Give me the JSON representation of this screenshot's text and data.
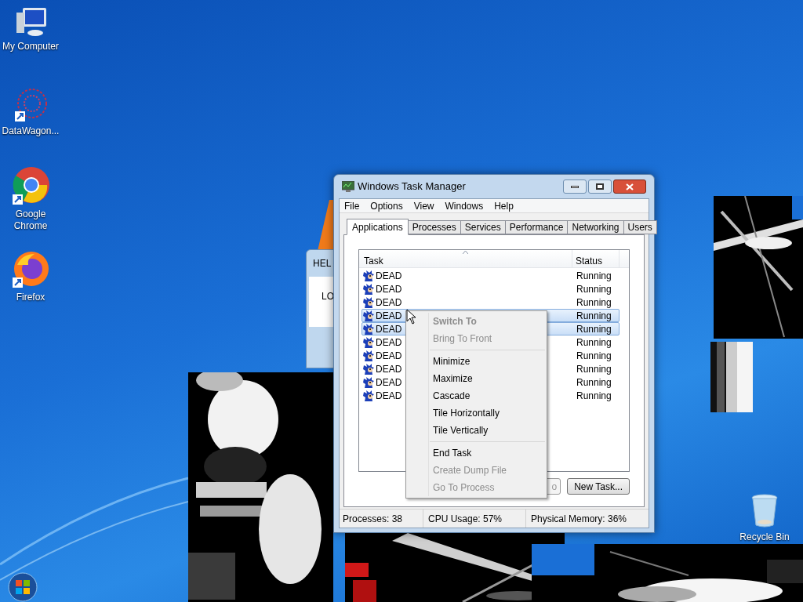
{
  "desktop_icons": [
    {
      "label": "My Computer",
      "kind": "computer"
    },
    {
      "label": "DataWagon...",
      "kind": "web"
    },
    {
      "label": "Google Chrome",
      "kind": "chrome"
    },
    {
      "label": "Firefox",
      "kind": "firefox"
    },
    {
      "label": "Recycle Bin",
      "kind": "bin"
    }
  ],
  "background_dialog": {
    "title": "HEL",
    "text": "LO"
  },
  "task_manager": {
    "title": "Windows Task Manager",
    "menu": [
      "File",
      "Options",
      "View",
      "Windows",
      "Help"
    ],
    "tabs": [
      {
        "label": "Applications",
        "selected": true
      },
      {
        "label": "Processes",
        "selected": false
      },
      {
        "label": "Services",
        "selected": false
      },
      {
        "label": "Performance",
        "selected": false
      },
      {
        "label": "Networking",
        "selected": false
      },
      {
        "label": "Users",
        "selected": false
      }
    ],
    "columns": [
      "Task",
      "Status"
    ],
    "rows": [
      {
        "task": "DEAD",
        "status": "Running",
        "selected": false
      },
      {
        "task": "DEAD",
        "status": "Running",
        "selected": false
      },
      {
        "task": "DEAD",
        "status": "Running",
        "selected": false
      },
      {
        "task": "DEAD",
        "status": "Running",
        "selected": true
      },
      {
        "task": "DEAD",
        "status": "Running",
        "selected": true
      },
      {
        "task": "DEAD",
        "status": "Running",
        "selected": false
      },
      {
        "task": "DEAD",
        "status": "Running",
        "selected": false
      },
      {
        "task": "DEAD",
        "status": "Running",
        "selected": false
      },
      {
        "task": "DEAD",
        "status": "Running",
        "selected": false
      },
      {
        "task": "DEAD",
        "status": "Running",
        "selected": false
      }
    ],
    "buttons": [
      "o",
      "New Task..."
    ],
    "status_bar": [
      "Processes: 38",
      "CPU Usage: 57%",
      "Physical Memory: 36%"
    ]
  },
  "context_menu": [
    {
      "kind": "item",
      "label": "Switch To",
      "disabled": true,
      "default": true
    },
    {
      "kind": "item",
      "label": "Bring To Front",
      "disabled": true,
      "default": false
    },
    {
      "kind": "separator"
    },
    {
      "kind": "item",
      "label": "Minimize",
      "disabled": false,
      "default": false
    },
    {
      "kind": "item",
      "label": "Maximize",
      "disabled": false,
      "default": false
    },
    {
      "kind": "item",
      "label": "Cascade",
      "disabled": false,
      "default": false
    },
    {
      "kind": "item",
      "label": "Tile Horizontally",
      "disabled": false,
      "default": false
    },
    {
      "kind": "item",
      "label": "Tile Vertically",
      "disabled": false,
      "default": false
    },
    {
      "kind": "separator"
    },
    {
      "kind": "item",
      "label": "End Task",
      "disabled": false,
      "default": false
    },
    {
      "kind": "item",
      "label": "Create Dump File",
      "disabled": true,
      "default": false
    },
    {
      "kind": "item",
      "label": "Go To Process",
      "disabled": true,
      "default": false
    }
  ]
}
